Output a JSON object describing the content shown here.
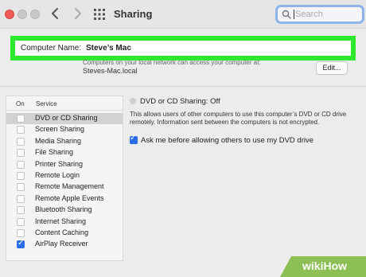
{
  "window": {
    "title": "Sharing"
  },
  "search": {
    "placeholder": "Search"
  },
  "computer_name": {
    "label": "Computer Name:",
    "value": "Steve’s Mac",
    "info_line1": "Computers on your local network can access your computer at:",
    "info_line2": "Steves-Mac.local",
    "edit_label": "Edit..."
  },
  "services": {
    "header_on": "On",
    "header_service": "Service",
    "items": [
      {
        "label": "DVD or CD Sharing",
        "checked": false,
        "selected": true
      },
      {
        "label": "Screen Sharing",
        "checked": false,
        "selected": false
      },
      {
        "label": "Media Sharing",
        "checked": false,
        "selected": false
      },
      {
        "label": "File Sharing",
        "checked": false,
        "selected": false
      },
      {
        "label": "Printer Sharing",
        "checked": false,
        "selected": false
      },
      {
        "label": "Remote Login",
        "checked": false,
        "selected": false
      },
      {
        "label": "Remote Management",
        "checked": false,
        "selected": false
      },
      {
        "label": "Remote Apple Events",
        "checked": false,
        "selected": false
      },
      {
        "label": "Bluetooth Sharing",
        "checked": false,
        "selected": false
      },
      {
        "label": "Internet Sharing",
        "checked": false,
        "selected": false
      },
      {
        "label": "Content Caching",
        "checked": false,
        "selected": false
      },
      {
        "label": "AirPlay Receiver",
        "checked": true,
        "selected": false
      }
    ]
  },
  "detail": {
    "status": "DVD or CD Sharing: Off",
    "description": "This allows users of other computers to use this computer’s DVD or CD drive remotely. Information sent between the computers is not encrypted.",
    "ask_label": "Ask me before allowing others to use my DVD drive",
    "ask_checked": true
  },
  "watermark": {
    "text": "wikiHow"
  },
  "colors": {
    "highlight": "#2ee82e",
    "accent": "#2b6de8",
    "close": "#ee5c55"
  }
}
